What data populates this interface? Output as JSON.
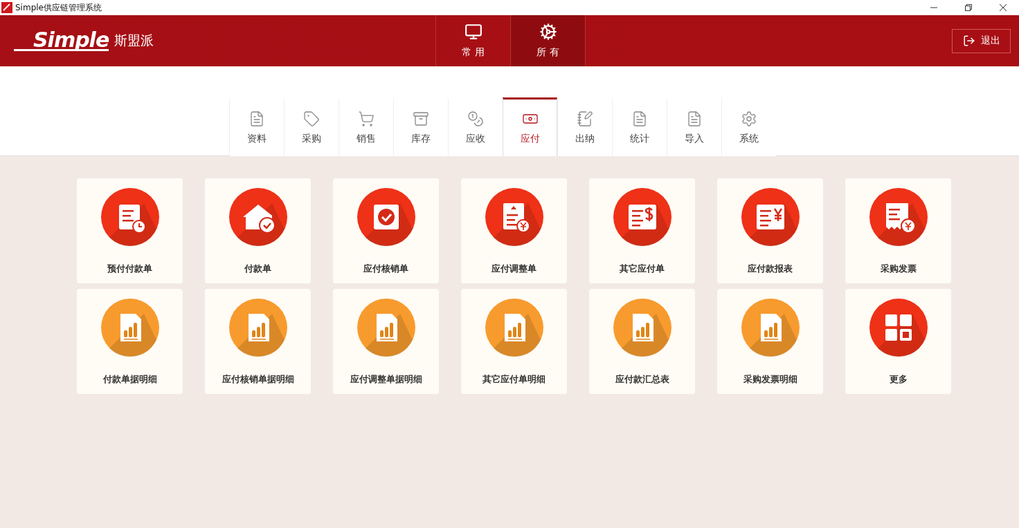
{
  "window": {
    "title": "Simple供应链管理系统"
  },
  "header": {
    "logo_text": "Simple",
    "brand": "斯盟派",
    "nav": [
      {
        "label": "常 用",
        "kind": "monitor",
        "selected": false
      },
      {
        "label": "所 有",
        "kind": "gear",
        "selected": true
      }
    ],
    "logout": "退出"
  },
  "tabs": [
    {
      "label": "资料",
      "kind": "doc",
      "selected": false
    },
    {
      "label": "采购",
      "kind": "tag",
      "selected": false
    },
    {
      "label": "销售",
      "kind": "cart",
      "selected": false
    },
    {
      "label": "库存",
      "kind": "tray",
      "selected": false
    },
    {
      "label": "应收",
      "kind": "coins",
      "selected": false
    },
    {
      "label": "应付",
      "kind": "cash",
      "selected": true
    },
    {
      "label": "出纳",
      "kind": "notebook",
      "selected": false
    },
    {
      "label": "统计",
      "kind": "doc",
      "selected": false
    },
    {
      "label": "导入",
      "kind": "doc",
      "selected": false
    },
    {
      "label": "系统",
      "kind": "gear",
      "selected": false
    }
  ],
  "tiles": [
    {
      "label": "预付付款单",
      "kind": "doc-clock",
      "color": "#ee3117"
    },
    {
      "label": "付款单",
      "kind": "house-check",
      "color": "#ee3117"
    },
    {
      "label": "应付核销单",
      "kind": "badge-check",
      "color": "#ee3117"
    },
    {
      "label": "应付调整单",
      "kind": "doc-up-yen",
      "color": "#ee3117"
    },
    {
      "label": "其它应付单",
      "kind": "doc-dollar",
      "color": "#ee3117"
    },
    {
      "label": "应付款报表",
      "kind": "doc-yen",
      "color": "#ee3117"
    },
    {
      "label": "采购发票",
      "kind": "receipt-yen",
      "color": "#ee3117"
    },
    {
      "label": "付款单据明细",
      "kind": "doc-chart",
      "color": "#f89b2e"
    },
    {
      "label": "应付核销单据明细",
      "kind": "doc-chart",
      "color": "#f89b2e"
    },
    {
      "label": "应付调整单据明细",
      "kind": "doc-chart",
      "color": "#f89b2e"
    },
    {
      "label": "其它应付单明细",
      "kind": "doc-chart",
      "color": "#f89b2e"
    },
    {
      "label": "应付款汇总表",
      "kind": "doc-chart",
      "color": "#f89b2e"
    },
    {
      "label": "采购发票明细",
      "kind": "doc-chart",
      "color": "#f89b2e"
    },
    {
      "label": "更多",
      "kind": "grid",
      "color": "#ee3117"
    }
  ]
}
